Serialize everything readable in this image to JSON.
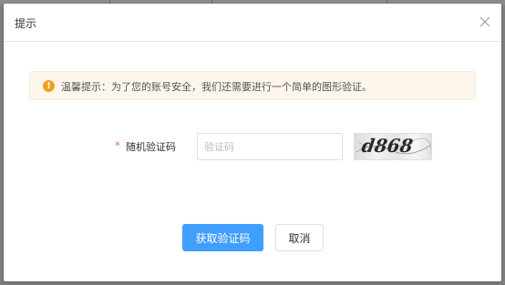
{
  "dialog": {
    "title": "提示",
    "close_icon": "close-icon"
  },
  "notice": {
    "icon": "warning-icon",
    "icon_glyph": "!",
    "text": "温馨提示：为了您的账号安全，我们还需要进行一个简单的图形验证。",
    "accent_color": "#f0a020"
  },
  "form": {
    "required_mark": "*",
    "label": "随机验证码",
    "input": {
      "value": "",
      "placeholder": "验证码"
    },
    "captcha_text": "d868"
  },
  "buttons": {
    "submit_label": "获取验证码",
    "cancel_label": "取消",
    "primary_color": "#409eff"
  }
}
